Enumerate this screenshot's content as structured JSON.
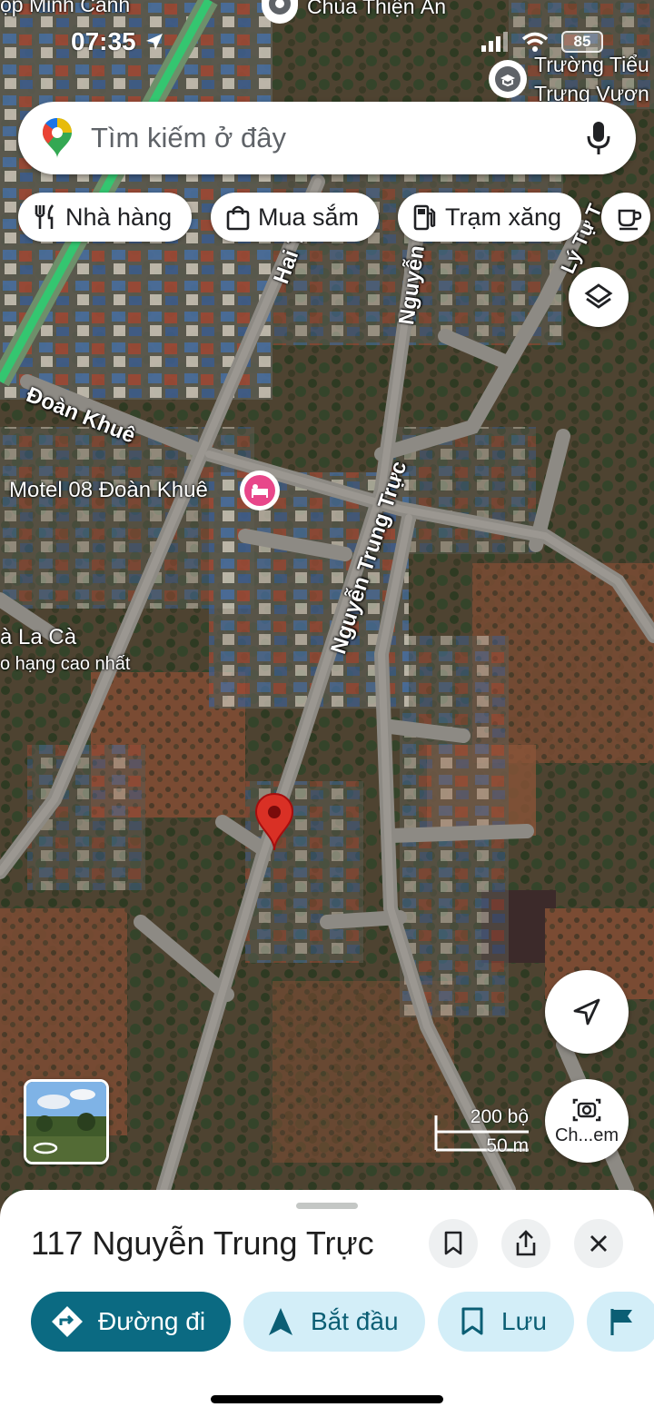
{
  "status_bar": {
    "time": "07:35",
    "battery": "85"
  },
  "search": {
    "placeholder": "Tìm kiếm ở đây"
  },
  "chips": [
    {
      "label": "Nhà hàng",
      "icon": "restaurant-icon"
    },
    {
      "label": "Mua sắm",
      "icon": "shopping-bag-icon"
    },
    {
      "label": "Trạm xăng",
      "icon": "gas-station-icon"
    }
  ],
  "map": {
    "street_labels": {
      "doan_khue": "Đoàn Khuê",
      "nguyen_trung_truc": "Nguyễn Trung Trực",
      "nguyen": "Nguyễn",
      "hai": "Hai T",
      "ly_tu": "Lý Tự T"
    },
    "poi_labels": {
      "chua": "Chùa Thiện Ân",
      "truong_line1": "Trường Tiểu",
      "truong_line2": "Trưng Vươn",
      "motel": "Motel 08 Đoàn Khuê",
      "la_ca": "à La Cà",
      "la_ca_sub": "o hạng cao nhất",
      "top_left": "ộp Minh Cảnh"
    },
    "scale": {
      "feet": "200 bộ",
      "meters": "50 m"
    },
    "camera_button_label": "Ch...em",
    "pin_color": "#d93025"
  },
  "place": {
    "title": "117 Nguyễn Trung Trực"
  },
  "actions": {
    "directions": "Đường đi",
    "start": "Bắt đầu",
    "save": "Lưu"
  },
  "colors": {
    "primary": "#0b6a82",
    "secondary_bg": "#d3eef8",
    "motel_pin": "#e8478a"
  }
}
